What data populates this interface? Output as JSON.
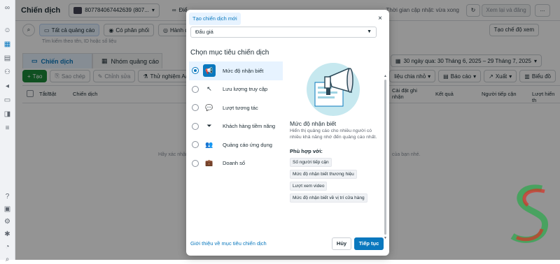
{
  "topbar": {
    "title": "Chiến dịch",
    "account": "807784067442639 (807...",
    "account_second": "Điể",
    "updated": "Thời gian cập nhật: vừa xong",
    "review_label": "Xem lại và đăng",
    "more_label": "..."
  },
  "filters": {
    "all_ads": "Tất cả quảng cáo",
    "has_delivery": "Có phân phối",
    "actions": "Hành động",
    "create_view": "Tạo chế độ xem",
    "search_placeholder": "Tìm kiếm theo tên, ID hoặc số liệu"
  },
  "tabs": [
    {
      "label": "Chiến dịch"
    },
    {
      "label": "Nhóm quảng cáo"
    }
  ],
  "date_range": "30 ngày qua: 30 Tháng 6, 2025 – 29 Tháng 7, 2025",
  "actions_bar": {
    "create": "Tạo",
    "duplicate": "Sao chép",
    "edit": "Chỉnh sửa",
    "ab_test": "Thử nghiệm A/B",
    "breakdown": "liệu chia nhỏ",
    "reports": "Báo cáo",
    "export": "Xuất",
    "chart": "Biểu đồ"
  },
  "table_headers": [
    "Tắt/Bật",
    "Chiến dịch",
    "Cài đặt ghi nhận",
    "Kết quả",
    "Người tiếp cận",
    "Lượt hiển th"
  ],
  "empty_text_left": "Hãy xác nhận",
  "empty_text_right": "của bạn nhé.",
  "modal": {
    "header_tab": "Tạo chiến dịch mới",
    "close": "×",
    "buying_type": "Đấu giá",
    "section_title": "Chọn mục tiêu chiến dịch",
    "objectives": [
      {
        "label": "Mức độ nhận biết",
        "icon": "megaphone-icon",
        "glyph": "📢"
      },
      {
        "label": "Lưu lượng truy cập",
        "icon": "cursor-icon",
        "glyph": "↖"
      },
      {
        "label": "Lượt tương tác",
        "icon": "chat-bubbles-icon",
        "glyph": "💬"
      },
      {
        "label": "Khách hàng tiềm năng",
        "icon": "funnel-icon",
        "glyph": "⏷"
      },
      {
        "label": "Quảng cáo ứng dụng",
        "icon": "people-icon",
        "glyph": "👥"
      },
      {
        "label": "Doanh số",
        "icon": "briefcase-icon",
        "glyph": "💼"
      }
    ],
    "detail": {
      "title": "Mức độ nhận biết",
      "description": "Hiển thị quảng cáo cho nhiều người có nhiều khả năng nhớ đến quảng cáo nhất.",
      "good_for": "Phù hợp với:",
      "tags": [
        "Số người tiếp cận",
        "Mức độ nhận biết thương hiệu",
        "Lượt xem video",
        "Mức độ nhận biết về vị trí cửa hàng"
      ]
    },
    "learn_link": "Giới thiệu về mục tiêu chiến dịch",
    "cancel": "Hủy",
    "continue": "Tiếp tục"
  },
  "colors": {
    "accent": "#0a78be",
    "create_green": "#1c8a3a",
    "selected_bg": "#e7f3ff"
  }
}
